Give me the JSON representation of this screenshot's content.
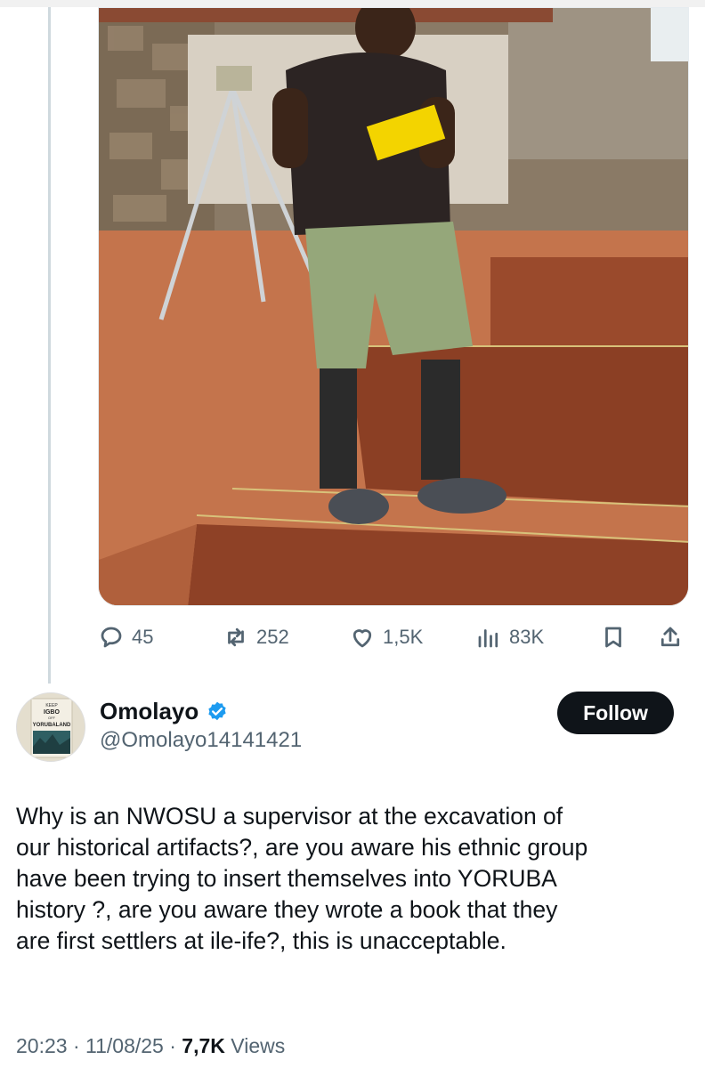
{
  "media": {
    "alt": ""
  },
  "actions": {
    "replies": "45",
    "reposts": "252",
    "likes": "1,5K",
    "views": "83K",
    "reply_icon": "reply-icon",
    "repost_icon": "repost-icon",
    "like_icon": "heart-icon",
    "views_icon": "views-icon",
    "bookmark_icon": "bookmark-icon",
    "share_icon": "share-icon"
  },
  "author": {
    "name": "Omolayo",
    "handle": "@Omolayo14141421",
    "verified": true,
    "avatar_book": {
      "line1": "KEEP",
      "line2": "IGBO",
      "line3": "OFF",
      "line4": "YORUBALAND"
    }
  },
  "follow": {
    "label": "Follow"
  },
  "tweet": {
    "lines": [
      "Why is an NWOSU a supervisor at the excavation of",
      "our historical artifacts?, are you aware his ethnic group",
      "have been trying to insert themselves into YORUBA",
      "history ?, are you aware they wrote a book that they",
      "are first settlers at ile-ife?, this is unacceptable."
    ]
  },
  "meta": {
    "time": "20:23",
    "sep1": " · ",
    "date": "11/08/25",
    "sep2": " · ",
    "views": "7,7K",
    "views_label": " Views"
  },
  "colors": {
    "accent": "#1d9bf0",
    "text": "#0f1419",
    "muted": "#536471",
    "button_bg": "#0f1419"
  }
}
